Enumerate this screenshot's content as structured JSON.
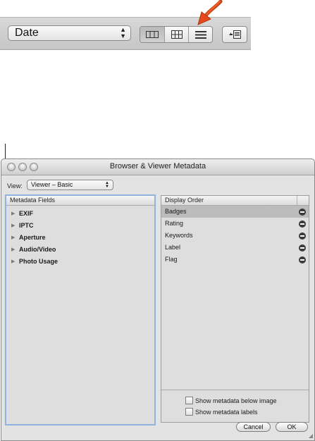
{
  "toolbar": {
    "sort_popup_value": "Date",
    "popup_arrows": "▲\n▼",
    "view_buttons": [
      {
        "icon": "filmstrip-view-icon",
        "selected": true
      },
      {
        "icon": "grid-view-icon",
        "selected": false
      },
      {
        "icon": "list-view-icon",
        "selected": false
      }
    ],
    "browser_only_icon": "browser-only-toggle-icon"
  },
  "callout": {
    "color": "#e8491c"
  },
  "window": {
    "title": "Browser & Viewer Metadata",
    "view_label": "View:",
    "view_popup_value": "Viewer – Basic",
    "left_panel": {
      "header": "Metadata Fields",
      "items": [
        {
          "label": "EXIF"
        },
        {
          "label": "IPTC"
        },
        {
          "label": "Aperture"
        },
        {
          "label": "Audio/Video"
        },
        {
          "label": "Photo Usage"
        }
      ]
    },
    "right_panel": {
      "header": "Display Order",
      "items": [
        {
          "label": "Badges",
          "selected": true
        },
        {
          "label": "Rating",
          "selected": false
        },
        {
          "label": "Keywords",
          "selected": false
        },
        {
          "label": "Label",
          "selected": false
        },
        {
          "label": "Flag",
          "selected": false
        }
      ],
      "options": [
        {
          "label": "Show metadata below image",
          "checked": false
        },
        {
          "label": "Show metadata labels",
          "checked": false
        }
      ]
    },
    "buttons": {
      "cancel": "Cancel",
      "ok": "OK"
    }
  }
}
